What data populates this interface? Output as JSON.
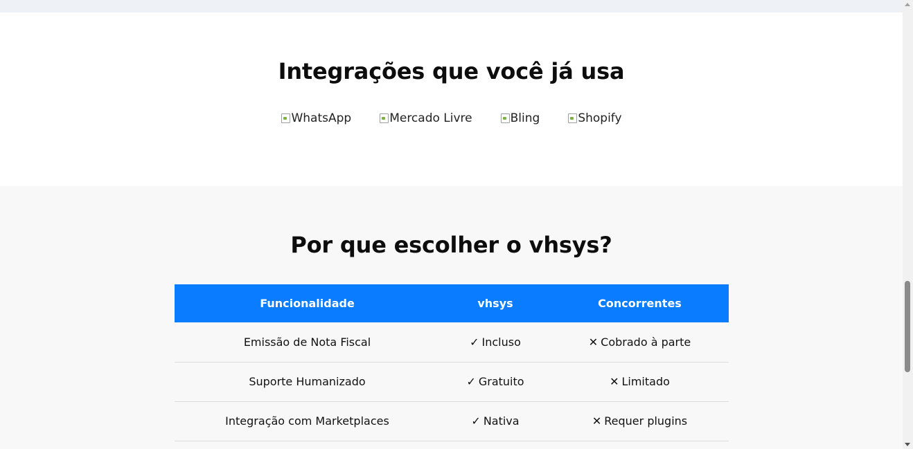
{
  "integrations": {
    "title": "Integrações que você já usa",
    "logos": [
      {
        "alt": "WhatsApp"
      },
      {
        "alt": "Mercado Livre"
      },
      {
        "alt": "Bling"
      },
      {
        "alt": "Shopify"
      }
    ]
  },
  "comparison": {
    "title": "Por que escolher o vhsys?",
    "header_color": "#0a7cff",
    "headers": [
      "Funcionalidade",
      "vhsys",
      "Concorrentes"
    ],
    "rows": [
      {
        "feature": "Emissão de Nota Fiscal",
        "vhsys_symbol": "✓",
        "vhsys": "Incluso",
        "comp_symbol": "✕",
        "competitors": "Cobrado à parte"
      },
      {
        "feature": "Suporte Humanizado",
        "vhsys_symbol": "✓",
        "vhsys": "Gratuito",
        "comp_symbol": "✕",
        "competitors": "Limitado"
      },
      {
        "feature": "Integração com Marketplaces",
        "vhsys_symbol": "✓",
        "vhsys": "Nativa",
        "comp_symbol": "✕",
        "competitors": "Requer plugins"
      }
    ]
  }
}
